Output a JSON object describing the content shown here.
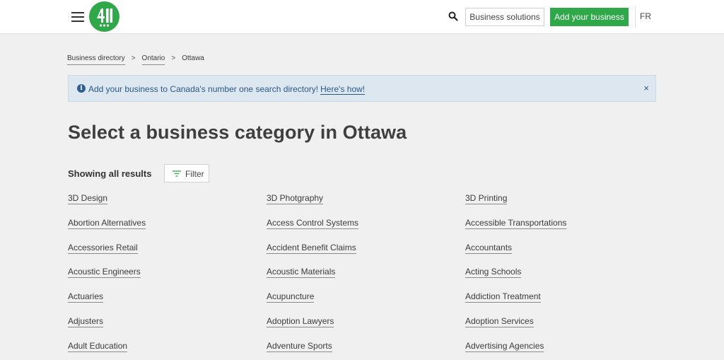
{
  "header": {
    "logo_text": "411",
    "business_solutions_label": "Business solutions",
    "add_business_label": "Add your business",
    "lang_label": "FR",
    "brand_color": "#2fa84a",
    "icons": [
      "hamburger-menu-icon",
      "search-icon"
    ]
  },
  "breadcrumb": {
    "items": [
      "Business directory",
      "Ontario",
      "Ottawa"
    ],
    "separator": ">"
  },
  "banner": {
    "text": "Add your business to Canada's number one search directory!",
    "link": "Here's how!",
    "info_glyph": "i",
    "close_glyph": "×",
    "bg_color": "#dce7f0"
  },
  "main": {
    "title": "Select a business category in Ottawa",
    "results_label": "Showing all results",
    "filter_label": "Filter"
  },
  "categories": {
    "col1": [
      "3D Design",
      "Abortion Alternatives",
      "Accessories Retail",
      "Acoustic Engineers",
      "Actuaries",
      "Adjusters",
      "Adult Education"
    ],
    "col2": [
      "3D Photgraphy",
      "Access Control Systems",
      "Accident Benefit Claims",
      "Acoustic Materials",
      "Acupuncture",
      "Adoption Lawyers",
      "Adventure Sports"
    ],
    "col3": [
      "3D Printing",
      "Accessible Transportations",
      "Accountants",
      "Acting Schools",
      "Addiction Treatment",
      "Adoption Services",
      "Advertising Agencies"
    ]
  }
}
